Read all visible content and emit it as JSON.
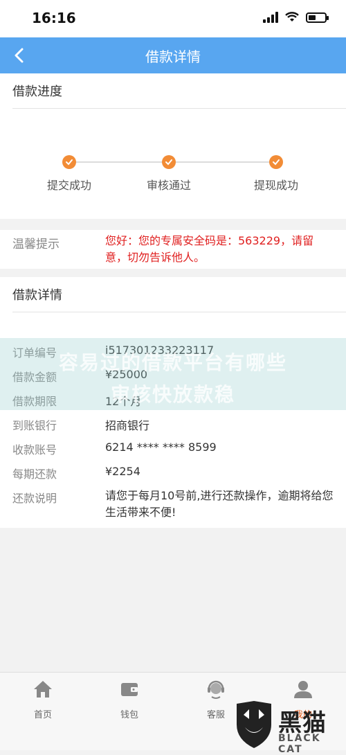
{
  "status_bar": {
    "time": "16:16"
  },
  "nav": {
    "title": "借款详情"
  },
  "progress": {
    "title": "借款进度",
    "steps": [
      "提交成功",
      "审核通过",
      "提现成功"
    ]
  },
  "tip": {
    "label": "温馨提示",
    "text": "您好：您的专属安全码是：563229，请留意，切勿告诉他人。"
  },
  "details": {
    "title": "借款详情",
    "rows": [
      {
        "key": "订单编号",
        "value": "i517301233223117"
      },
      {
        "key": "借款金额",
        "value": "¥25000"
      },
      {
        "key": "借款期限",
        "value": "12个月"
      },
      {
        "key": "到账银行",
        "value": "招商银行"
      },
      {
        "key": "收款账号",
        "value": "6214 **** **** 8599"
      },
      {
        "key": "每期还款",
        "value": "¥2254"
      },
      {
        "key": "还款说明",
        "value": "请您于每月10号前,进行还款操作，逾期将给您生活带来不便!"
      }
    ]
  },
  "watermark": {
    "line1": "容易过的借款平台有哪些",
    "line2": "审核快放款稳"
  },
  "tabs": [
    {
      "label": "首页"
    },
    {
      "label": "钱包"
    },
    {
      "label": "客服"
    },
    {
      "label": "我的"
    }
  ],
  "logo": {
    "text": "黑猫",
    "sub": "BLACK CAT"
  },
  "colors": {
    "nav": "#58a6f0",
    "step": "#f28c36",
    "tip": "#e02020"
  }
}
